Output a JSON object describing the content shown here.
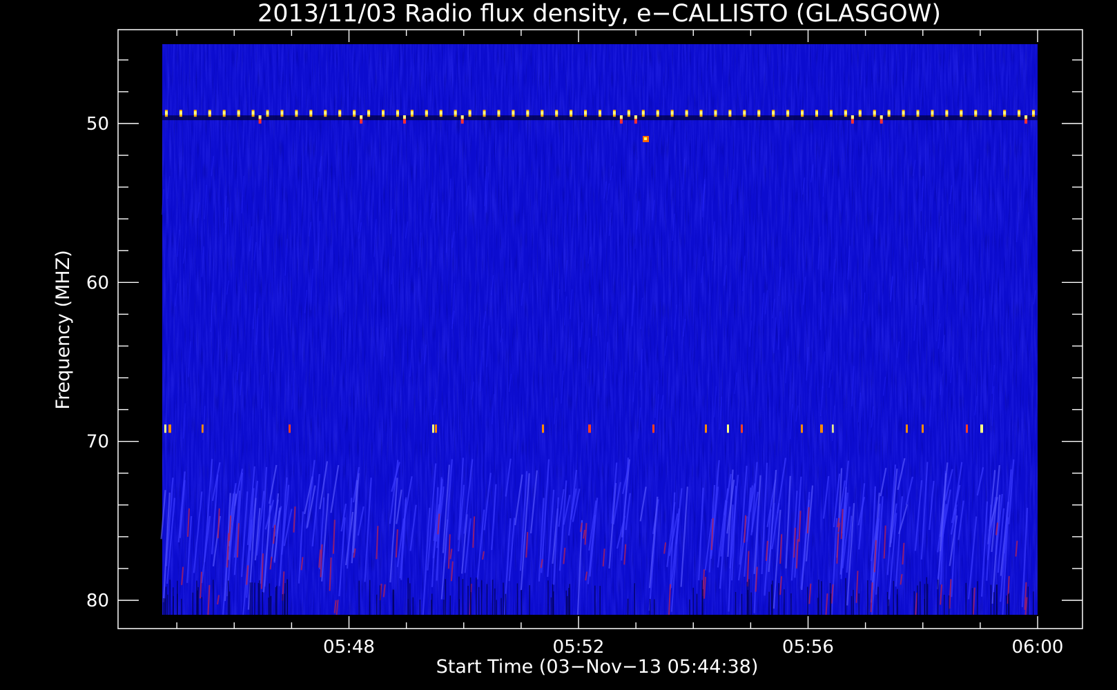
{
  "chart_data": {
    "type": "heatmap",
    "title": "2013/11/03  Radio flux density, e−CALLISTO (GLASGOW)",
    "xlabel": "Start Time (03−Nov−13 05:44:38)",
    "ylabel": "Frequency (MHZ)",
    "x_ticks": [
      "05:48",
      "05:52",
      "05:56",
      "06:00"
    ],
    "y_ticks": [
      50,
      60,
      70,
      80
    ],
    "y_inverted": true,
    "x_range_minutes": [
      5744,
      6000
    ],
    "y_range_mhz": [
      45,
      81
    ],
    "colormap": [
      "#000000",
      "#00008c",
      "#1a1aff",
      "#ff2a2a",
      "#ffff66",
      "#ffffff"
    ],
    "background_level_color": "#0c0ccf",
    "interference_lines_mhz": [
      49.4,
      69.2
    ],
    "bright_spot": {
      "time": "05:53:10",
      "mhz": 51.0
    },
    "grid": false
  }
}
